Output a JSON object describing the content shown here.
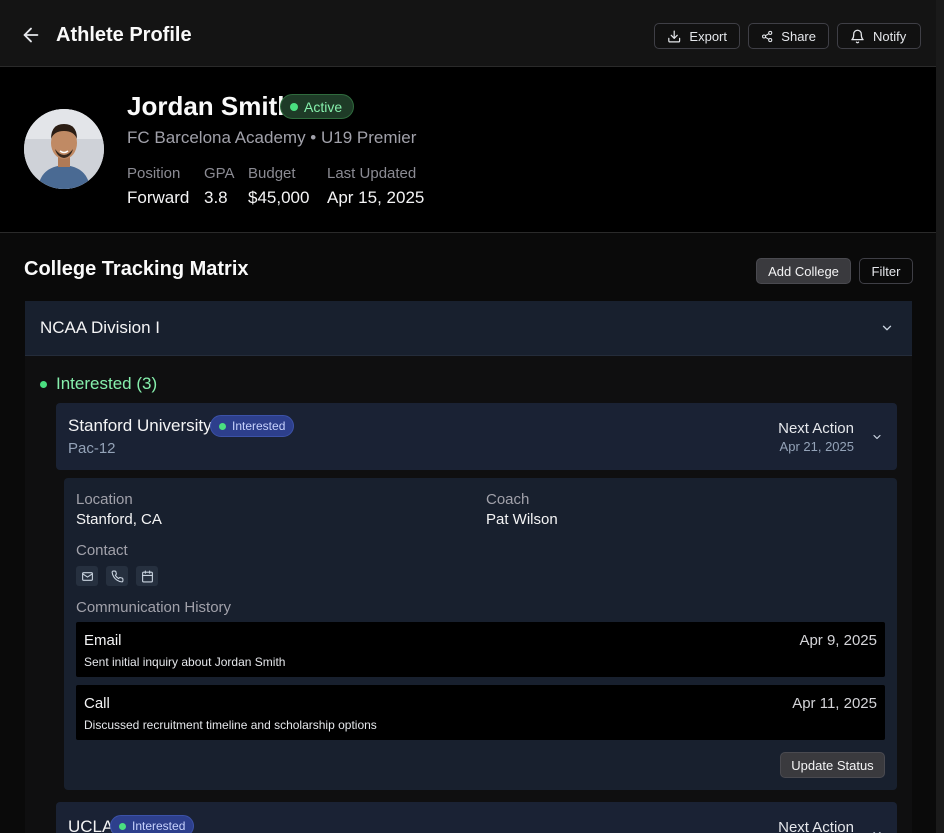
{
  "header": {
    "title": "Athlete Profile",
    "back_icon": "arrow-left-icon",
    "actions": [
      {
        "label": "Export",
        "icon": "download-icon"
      },
      {
        "label": "Share",
        "icon": "share-icon"
      },
      {
        "label": "Notify",
        "icon": "bell-icon"
      }
    ]
  },
  "athlete": {
    "name": "Jordan Smith",
    "status": "Active",
    "club": "FC Barcelona Academy • U19 Premier",
    "stats": [
      {
        "label": "Position",
        "value": "Forward"
      },
      {
        "label": "GPA",
        "value": "3.8"
      },
      {
        "label": "Budget",
        "value": "$45,000"
      },
      {
        "label": "Last Updated",
        "value": "Apr 15, 2025"
      }
    ]
  },
  "matrix": {
    "title": "College Tracking Matrix",
    "add_label": "Add College",
    "filter_label": "Filter",
    "division": {
      "title": "NCAA Division I",
      "group_label": "Interested (3)",
      "colleges": [
        {
          "name": "Stanford University",
          "status": "Interested",
          "conference": "Pac-12",
          "next_action_label": "Next Action",
          "next_action_date": "Apr 21, 2025",
          "details": {
            "location_label": "Location",
            "location": "Stanford, CA",
            "coach_label": "Coach",
            "coach": "Pat Wilson",
            "contact_label": "Contact",
            "contact_icons": [
              "mail-icon",
              "phone-icon",
              "calendar-icon"
            ],
            "history_label": "Communication History",
            "history": [
              {
                "type": "Email",
                "description": "Sent initial inquiry about Jordan Smith",
                "date": "Apr 9, 2025"
              },
              {
                "type": "Call",
                "description": "Discussed recruitment timeline and scholarship options",
                "date": "Apr 11, 2025"
              }
            ],
            "update_label": "Update Status"
          }
        },
        {
          "name": "UCLA",
          "status": "Interested",
          "next_action_label": "Next Action"
        }
      ]
    }
  },
  "colors": {
    "accent_green": "#4ade80",
    "pill_blue": "#2d3f8c",
    "card_bg": "#1a2234"
  }
}
